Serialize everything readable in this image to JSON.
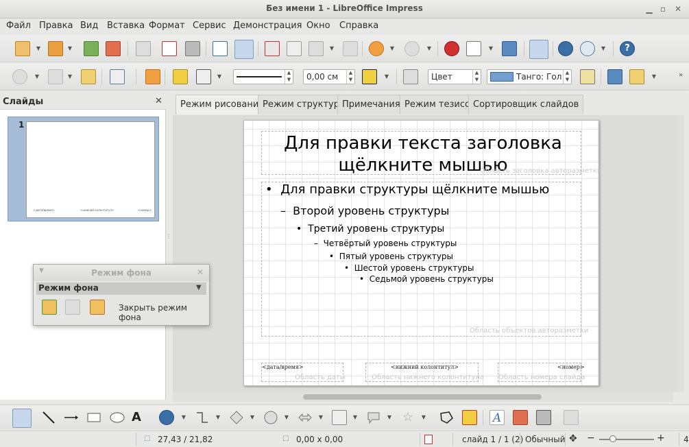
{
  "window": {
    "title": "Без имени 1 - LibreOffice Impress"
  },
  "menu": [
    "Файл",
    "Правка",
    "Вид",
    "Вставка",
    "Формат",
    "Сервис",
    "Демонстрация",
    "Окно",
    "Справка"
  ],
  "toolbar2": {
    "line_width_value": "0,00 см",
    "area_style": "Цвет",
    "area_fill": "Танго: Гол"
  },
  "slides_pane": {
    "title": "Слайды",
    "slide_number": "1",
    "thumb_footer_left": "<дата/время>",
    "thumb_footer_center": "<нижний колонтитул>",
    "thumb_footer_right": "<номер>"
  },
  "view_tabs": [
    "Режим рисования",
    "Режим структуры",
    "Примечания",
    "Режим тезисов",
    "Сортировщик слайдов"
  ],
  "slide": {
    "title": "Для правки текста заголовка щёлкните мышью",
    "title_area_label": "Область заголовка авторазметки",
    "outline": [
      {
        "bullet": "•",
        "text": "Для правки структуры щёлкните мышью"
      },
      {
        "bullet": "–",
        "text": "Второй уровень структуры"
      },
      {
        "bullet": "•",
        "text": "Третий уровень структуры"
      },
      {
        "bullet": "–",
        "text": "Четвёртый уровень структуры"
      },
      {
        "bullet": "•",
        "text": "Пятый уровень структуры"
      },
      {
        "bullet": "•",
        "text": "Шестой уровень структуры"
      },
      {
        "bullet": "•",
        "text": "Седьмой уровень структуры"
      }
    ],
    "objects_area_label": "Область объектов авторазметки",
    "footer_date": "<дата/время>",
    "footer_center": "<нижний колонтитул>",
    "footer_number": "<номер>",
    "date_area_label": "Область даты",
    "footer_area_label": "Область нижнего колонтитула",
    "number_area_label": "Область номера слайда"
  },
  "master_view": {
    "window_title": "Режим фона",
    "toolbar_title": "Режим фона",
    "close_label": "Закрыть режим фона"
  },
  "status": {
    "position": "27,43 / 21,82",
    "size": "0,00 x 0,00",
    "slide": "слайд 1 / 1 (2)",
    "layout": "Обычный",
    "zoom": "4"
  },
  "colors": {
    "accent_blue": "#729fcf",
    "selection": "#a7bcd6"
  }
}
